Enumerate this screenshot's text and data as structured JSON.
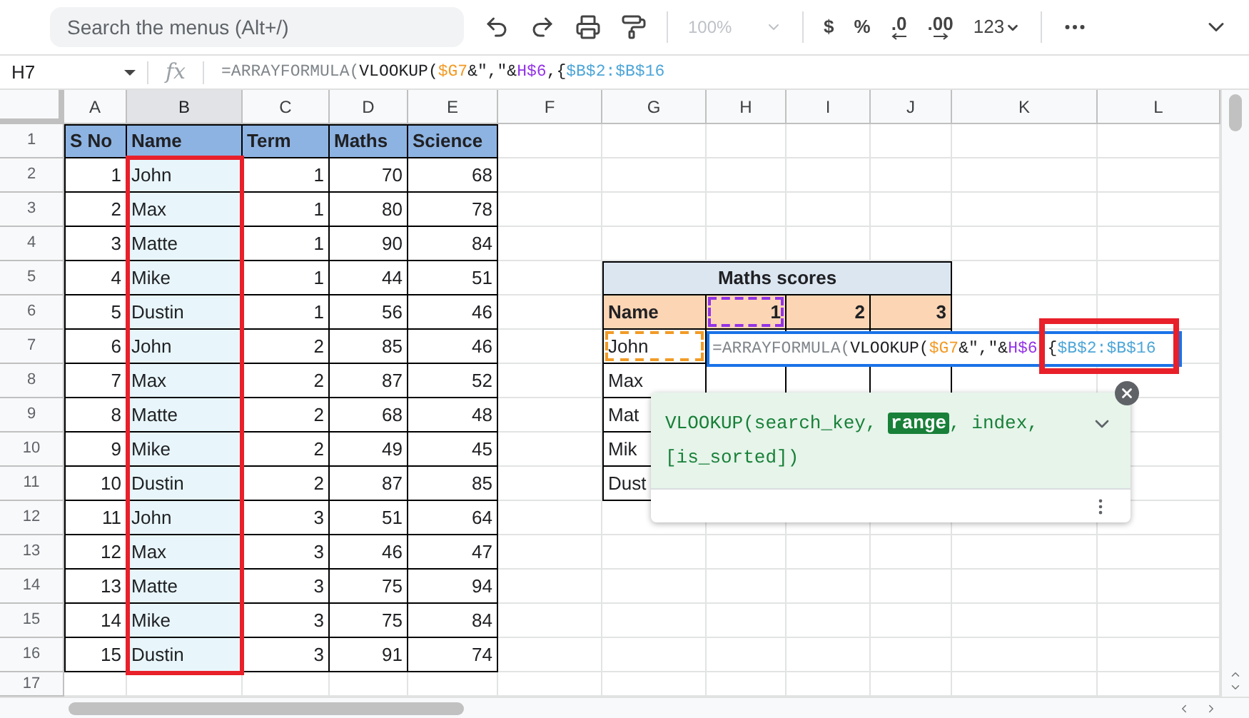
{
  "toolbar": {
    "search": {
      "placeholder": "Search the menus (Alt+/)"
    },
    "zoom": {
      "label": "100%",
      "disabled": true
    },
    "format_buttons": [
      {
        "label": "$",
        "kind": "plain"
      },
      {
        "label": "%",
        "kind": "plain"
      },
      {
        "label": ".0",
        "kind": "decrease"
      },
      {
        "label": ".00",
        "kind": "increase"
      },
      {
        "label": "123",
        "kind": "dropdown"
      }
    ]
  },
  "formula_bar": {
    "cell_ref": "H7",
    "fx": "fx",
    "formula": [
      {
        "text": "=ARRAYFORMULA(",
        "color": "#80868b"
      },
      {
        "text": "VLOOKUP(",
        "color": "#202124"
      },
      {
        "text": "$G7",
        "color": "#f29b26"
      },
      {
        "text": "&\",\"&",
        "color": "#202124"
      },
      {
        "text": "H$6",
        "color": "#9334e6"
      },
      {
        "text": ",{",
        "color": "#202124"
      },
      {
        "text": "$B$2:$B$16",
        "color": "#4ea6d8"
      }
    ]
  },
  "column_headers": [
    {
      "label": "A",
      "selected": false
    },
    {
      "label": "B",
      "selected": true
    },
    {
      "label": "C",
      "selected": false
    },
    {
      "label": "D",
      "selected": false
    },
    {
      "label": "E",
      "selected": false
    },
    {
      "label": "F",
      "selected": false
    },
    {
      "label": "G",
      "selected": false
    },
    {
      "label": "H",
      "selected": false
    },
    {
      "label": "I",
      "selected": false
    },
    {
      "label": "J",
      "selected": false
    },
    {
      "label": "K",
      "selected": false
    },
    {
      "label": "L",
      "selected": false
    }
  ],
  "row_headers": [
    "1",
    "2",
    "3",
    "4",
    "5",
    "6",
    "7",
    "8",
    "9",
    "10",
    "11",
    "12",
    "13",
    "14",
    "15",
    "16",
    "17"
  ],
  "table": {
    "columns": [
      "S No",
      "Name",
      "Term",
      "Maths",
      "Science"
    ],
    "rows": [
      [
        "1",
        "John",
        "1",
        "70",
        "68"
      ],
      [
        "2",
        "Max",
        "1",
        "80",
        "78"
      ],
      [
        "3",
        "Matte",
        "1",
        "90",
        "84"
      ],
      [
        "4",
        "Mike",
        "1",
        "44",
        "51"
      ],
      [
        "5",
        "Dustin",
        "1",
        "56",
        "46"
      ],
      [
        "6",
        "John",
        "2",
        "85",
        "46"
      ],
      [
        "7",
        "Max",
        "2",
        "87",
        "52"
      ],
      [
        "8",
        "Matte",
        "2",
        "68",
        "48"
      ],
      [
        "9",
        "Mike",
        "2",
        "49",
        "45"
      ],
      [
        "10",
        "Dustin",
        "2",
        "87",
        "85"
      ],
      [
        "11",
        "John",
        "3",
        "51",
        "64"
      ],
      [
        "12",
        "Max",
        "3",
        "46",
        "47"
      ],
      [
        "13",
        "Matte",
        "3",
        "75",
        "94"
      ],
      [
        "14",
        "Mike",
        "3",
        "75",
        "84"
      ],
      [
        "15",
        "Dustin",
        "3",
        "91",
        "74"
      ]
    ]
  },
  "maths_scores": {
    "title": "Maths scores",
    "columns": [
      {
        "label": "Name"
      },
      {
        "label": "1",
        "color": "#9334e6"
      },
      {
        "label": "2"
      },
      {
        "label": "3"
      }
    ],
    "rows": [
      {
        "name": "John",
        "color": "#f29b26"
      },
      {
        "name": "Max"
      },
      {
        "name": "Mat"
      },
      {
        "name": "Mik"
      },
      {
        "name": "Dust"
      }
    ]
  },
  "cell_editor": {
    "formula": [
      {
        "text": "=ARRAYFORMULA(",
        "color": "#80868b",
        "framed": false
      },
      {
        "text": "VLOOKUP(",
        "color": "#202124",
        "framed": false
      },
      {
        "text": "$G7",
        "color": "#f29b26",
        "framed": false
      },
      {
        "text": "&\",\"&",
        "color": "#202124",
        "framed": false
      },
      {
        "text": "H$6",
        "color": "#9334e6",
        "framed": false
      },
      {
        "text": "{",
        "color": "#202124",
        "framed": true
      },
      {
        "text": "$B$2:$B$16",
        "color": "#4ea6d8",
        "framed": true
      }
    ]
  },
  "tooltip": {
    "signature": [
      {
        "text": "VLOOKUP(search_key, ",
        "highlighted": false
      },
      {
        "text": "range",
        "highlighted": true
      },
      {
        "text": ", index, [is_sorted])",
        "highlighted": false
      }
    ]
  }
}
